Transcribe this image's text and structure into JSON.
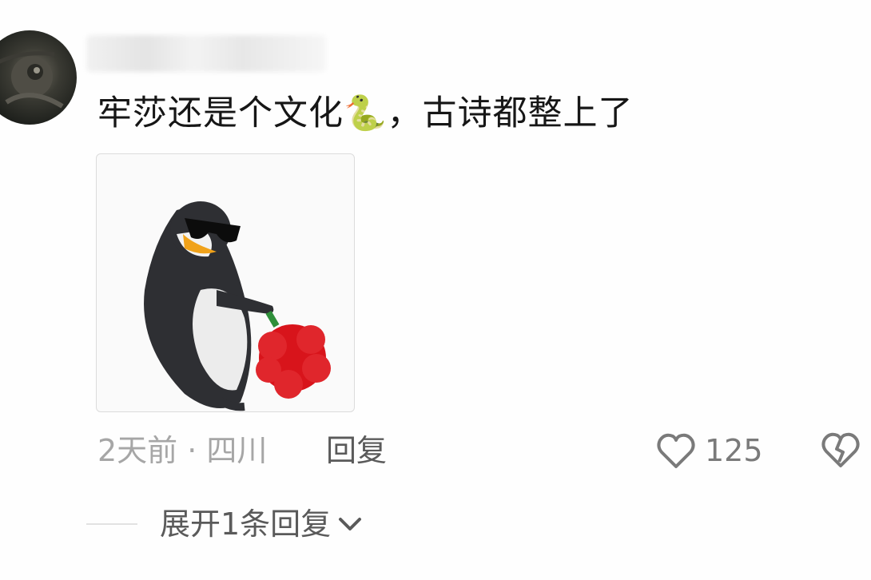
{
  "comment": {
    "text": "牢莎还是个文化🐍，古诗都整上了",
    "emoji_icon": "snake-emoji",
    "time_location": "2天前 · 四川",
    "reply_label": "回复",
    "like_count": "125",
    "expand_replies_label": "展开1条回复"
  },
  "colors": {
    "text_primary": "#161616",
    "text_meta": "#a6a6a6",
    "text_action": "#5a5a5a",
    "icon_gray": "#7a7a7a"
  }
}
